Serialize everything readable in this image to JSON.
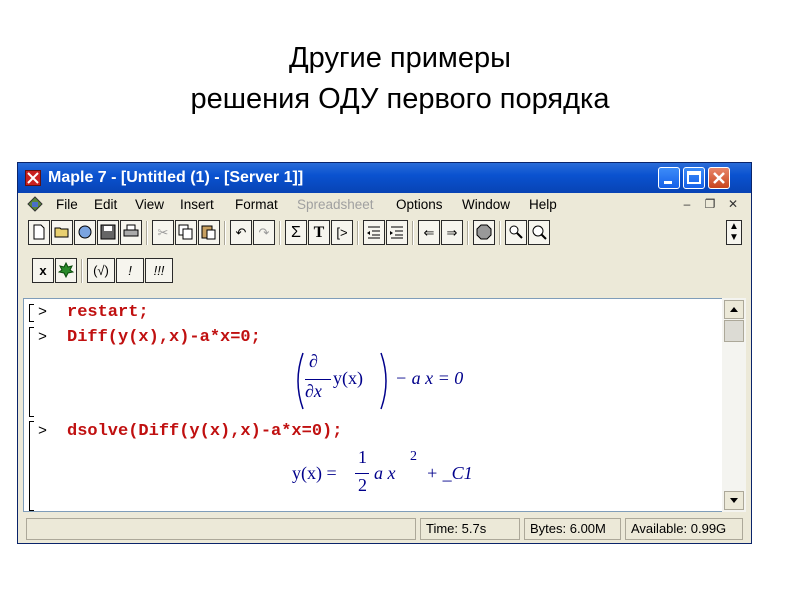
{
  "slide": {
    "title_line1": "Другие примеры",
    "title_line2": "решения ОДУ первого порядка"
  },
  "window": {
    "title": "Maple 7  - [Untitled (1) - [Server 1]]"
  },
  "menu": [
    {
      "label": "File",
      "enabled": true
    },
    {
      "label": "Edit",
      "enabled": true
    },
    {
      "label": "View",
      "enabled": true
    },
    {
      "label": "Insert",
      "enabled": true
    },
    {
      "label": "Format",
      "enabled": true
    },
    {
      "label": "Spreadsheet",
      "enabled": false
    },
    {
      "label": "Options",
      "enabled": true
    },
    {
      "label": "Window",
      "enabled": true
    },
    {
      "label": "Help",
      "enabled": true
    }
  ],
  "toolbar2": {
    "sigma": "Σ",
    "text_t": "T",
    "prompt_btn": "[>",
    "exec_check": "(√)",
    "exec_one": "!",
    "exec_all": "!!!",
    "x_btn": "x"
  },
  "worksheet": {
    "cmd1": "restart;",
    "cmd2": "Diff(y(x),x)-a*x=0;",
    "cmd3": "dsolve(Diff(y(x),x)-a*x=0);",
    "prompt": ">",
    "out1_partial": "∂",
    "out1_dx": "∂x",
    "out1_yx": "y(x)",
    "out1_rhs": "− a x = 0",
    "out2_lhs": "y(x) =",
    "out2_num": "1",
    "out2_den": "2",
    "out2_ax": "a x",
    "out2_exp": "2",
    "out2_tail": "+ _C1"
  },
  "status": {
    "time": "Time:   5.7s",
    "bytes": "Bytes: 6.00M",
    "available": "Available: 0.99G"
  }
}
